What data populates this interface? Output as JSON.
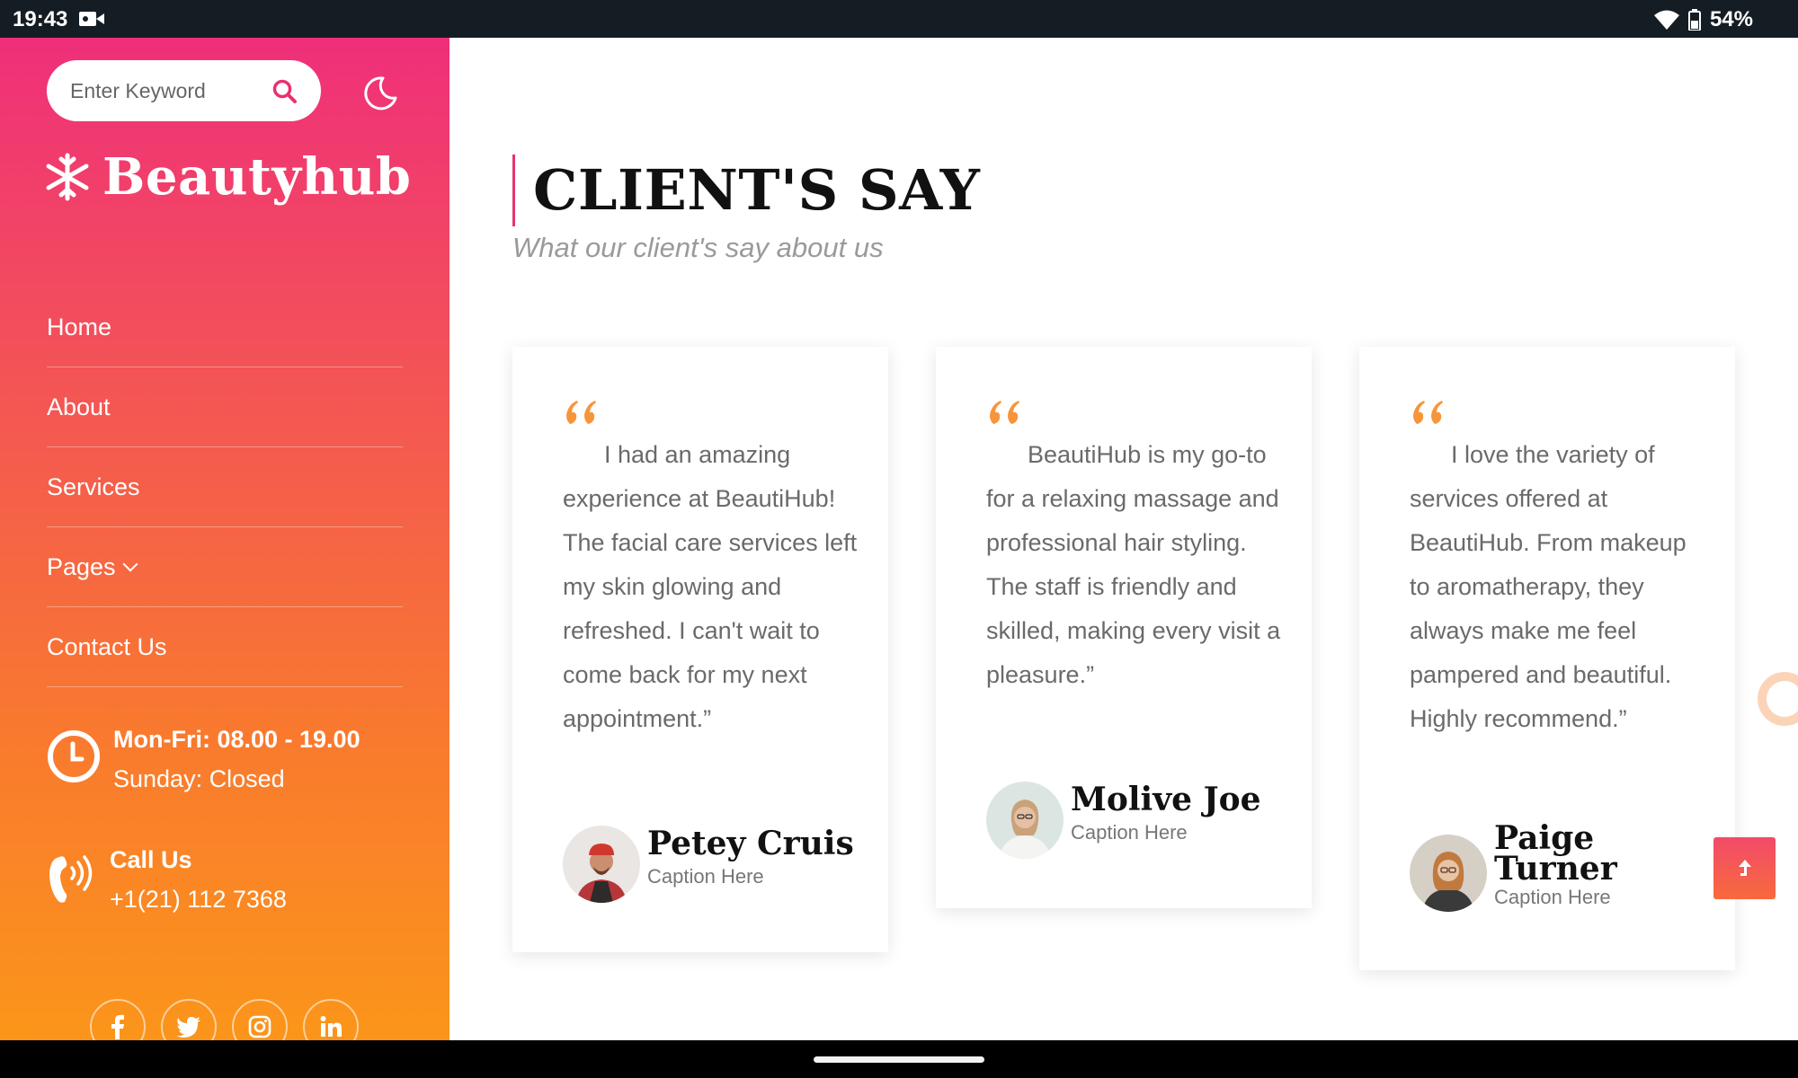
{
  "status_bar": {
    "time": "19:43",
    "battery": "54%"
  },
  "search": {
    "placeholder": "Enter Keyword"
  },
  "brand": {
    "name": "Beautyhub"
  },
  "menu": [
    {
      "label": "Home"
    },
    {
      "label": "About"
    },
    {
      "label": "Services"
    },
    {
      "label": "Pages"
    },
    {
      "label": "Contact Us"
    }
  ],
  "hours": {
    "weekday": "Mon-Fri: 08.00 - 19.00",
    "sunday": "Sunday: Closed"
  },
  "call": {
    "label": "Call Us",
    "number": "+1(21) 112 7368"
  },
  "socials": [
    "facebook-icon",
    "twitter-icon",
    "instagram-icon",
    "linkedin-icon"
  ],
  "section": {
    "title": "CLIENT'S SAY",
    "subtitle": "What our client's say about us"
  },
  "testimonials": [
    {
      "quote": "I had an amazing experience at BeautiHub! The facial care services left my skin glowing and refreshed. I can't wait to come back for my next appointment.”",
      "name": "Petey Cruis",
      "caption": "Caption Here"
    },
    {
      "quote": "BeautiHub is my go-to for a relaxing massage and professional hair styling. The staff is friendly and skilled, making every visit a pleasure.”",
      "name": "Molive Joe",
      "caption": "Caption Here"
    },
    {
      "quote": "I love the variety of services offered at BeautiHub. From makeup to aromatherapy, they always make me feel pampered and beautiful. Highly recommend.”",
      "name": "Paige Turner",
      "caption": "Caption Here"
    }
  ],
  "colors": {
    "accent": "#ef2f7a",
    "accent_orange": "#fb951a",
    "quote_mark": "#f7953b"
  }
}
